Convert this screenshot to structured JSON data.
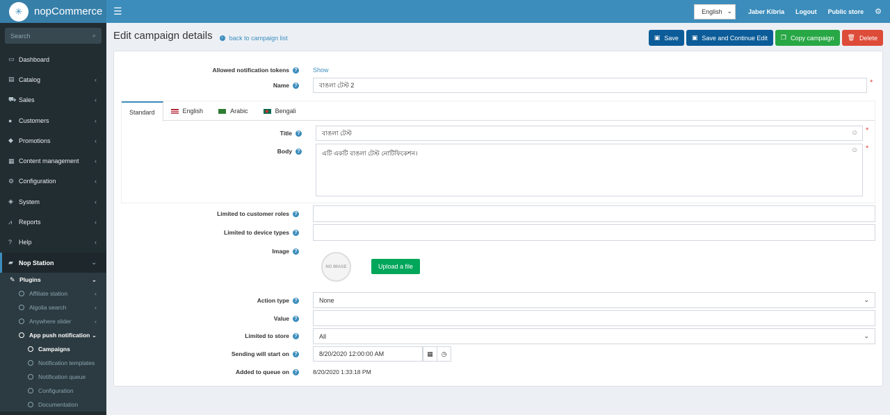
{
  "brand": {
    "name": "nopCommerce"
  },
  "header": {
    "language": "English",
    "user": "Jaber Kibria",
    "logout": "Logout",
    "public_store": "Public store"
  },
  "sidebar": {
    "search_placeholder": "Search",
    "items": [
      {
        "label": "Dashboard",
        "icon": "monitor-icon"
      },
      {
        "label": "Catalog",
        "icon": "book-icon"
      },
      {
        "label": "Sales",
        "icon": "cart-icon"
      },
      {
        "label": "Customers",
        "icon": "user-icon"
      },
      {
        "label": "Promotions",
        "icon": "tag-icon"
      },
      {
        "label": "Content management",
        "icon": "cubes-icon"
      },
      {
        "label": "Configuration",
        "icon": "gears-icon"
      },
      {
        "label": "System",
        "icon": "cube-icon"
      },
      {
        "label": "Reports",
        "icon": "line-chart-icon"
      },
      {
        "label": "Help",
        "icon": "question-icon"
      },
      {
        "label": "Nop Station",
        "icon": "folder-open-icon"
      }
    ],
    "plugins": "Plugins",
    "plugin_items": [
      {
        "label": "Affiliate station"
      },
      {
        "label": "Algolia search"
      },
      {
        "label": "Anywhere slider"
      },
      {
        "label": "App push notification"
      }
    ],
    "app_push_items": [
      {
        "label": "Campaigns"
      },
      {
        "label": "Notification templates"
      },
      {
        "label": "Notification queue"
      },
      {
        "label": "Configuration"
      },
      {
        "label": "Documentation"
      }
    ]
  },
  "page": {
    "title": "Edit campaign details",
    "back_link": "back to campaign list",
    "buttons": {
      "save": "Save",
      "save_continue": "Save and Continue Edit",
      "copy": "Copy campaign",
      "delete": "Delete"
    }
  },
  "form": {
    "allowed_tokens_label": "Allowed notification tokens",
    "allowed_tokens_link": "Show",
    "name_label": "Name",
    "name_value": "বাঙলা টেস্ট 2",
    "tabs": [
      "Standard",
      "English",
      "Arabic",
      "Bengali"
    ],
    "title_label": "Title",
    "title_value": "বাঙলা টেস্ট",
    "body_label": "Body",
    "body_value": "এটি একটি বাঙলা টেস্ট নোটিফিকেশন।",
    "roles_label": "Limited to customer roles",
    "devices_label": "Limited to device types",
    "image_label": "Image",
    "no_image": "NO IMAGE",
    "upload": "Upload a file",
    "action_label": "Action type",
    "action_value": "None",
    "value_label": "Value",
    "store_label": "Limited to store",
    "store_value": "All",
    "start_label": "Sending will start on",
    "start_value": "8/20/2020 12:00:00 AM",
    "queue_label": "Added to queue on",
    "queue_value": "8/20/2020 1:33:18 PM"
  }
}
